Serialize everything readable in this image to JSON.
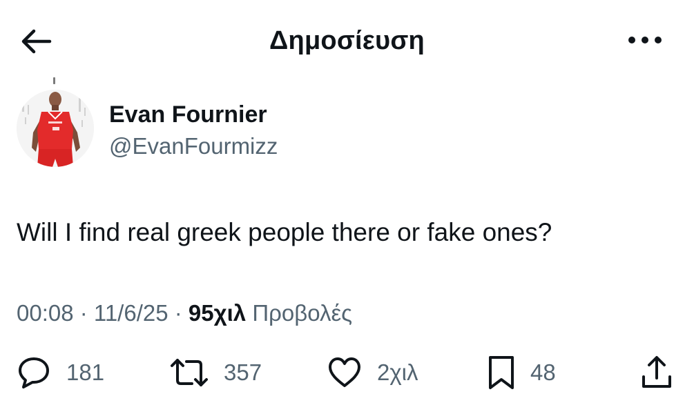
{
  "header": {
    "title": "Δημοσίευση"
  },
  "author": {
    "name": "Evan Fournier",
    "handle": "@EvanFourmizz"
  },
  "tweet": {
    "text": "Will I find real greek people there or fake ones?"
  },
  "meta": {
    "time": "00:08",
    "date": "11/6/25",
    "views_count": "95χιλ",
    "views_label": "Προβολές"
  },
  "actions": {
    "replies": "181",
    "reposts": "357",
    "likes": "2χιλ",
    "bookmarks": "48"
  },
  "icons": [
    "back-arrow-icon",
    "more-icon",
    "reply-icon",
    "repost-icon",
    "like-icon",
    "bookmark-icon",
    "share-icon"
  ]
}
